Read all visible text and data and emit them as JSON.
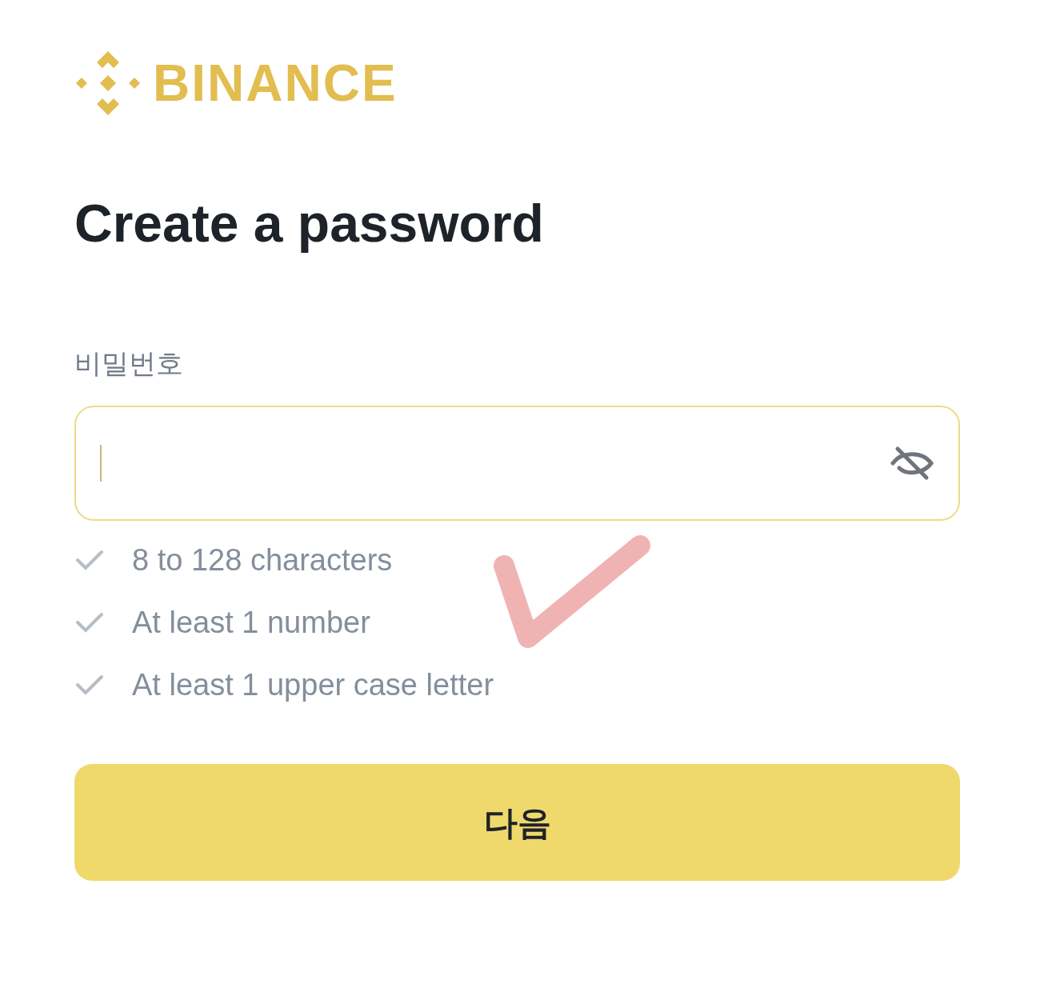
{
  "logo": {
    "text": "BINANCE"
  },
  "title": "Create a password",
  "password_field": {
    "label": "비밀번호",
    "focused": true
  },
  "requirements": [
    {
      "text": "8 to 128 characters",
      "met": false
    },
    {
      "text": "At least 1 number",
      "met": false
    },
    {
      "text": "At least 1 upper case letter",
      "met": false
    }
  ],
  "next_button": {
    "label": "다음"
  }
}
